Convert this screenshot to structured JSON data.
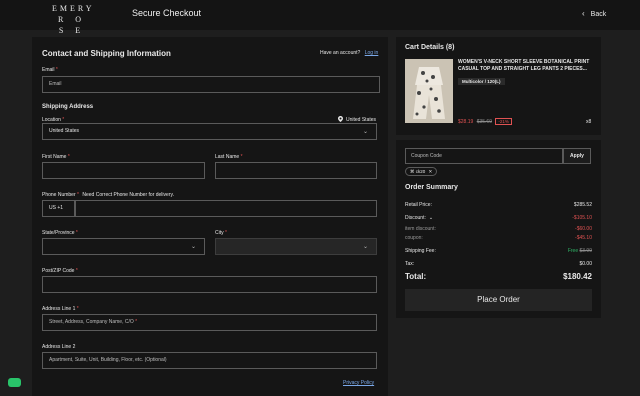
{
  "brand": {
    "line1": "EMERY",
    "line2": "R O S E"
  },
  "header": {
    "title": "Secure Checkout",
    "back_label": "Back"
  },
  "contact": {
    "title": "Contact and Shipping Information",
    "have_account": "Have an account?",
    "login_label": "Log in",
    "email_label": "Email",
    "email_placeholder": "Email"
  },
  "shipping": {
    "title": "Shipping Address",
    "location_label": "Location",
    "location_value": "United States",
    "location_hint": "United States",
    "first_name_label": "First Name",
    "last_name_label": "Last Name",
    "phone_label": "Phone Number",
    "phone_note": "Need Correct Phone Number for delivery.",
    "phone_code": "US +1",
    "state_label": "State/Province",
    "city_label": "City",
    "zip_label": "Post/ZIP Code",
    "address1_label": "Address Line 1",
    "address1_placeholder": "Street, Address, Company Name, C/O",
    "address2_label": "Address Line 2",
    "address2_placeholder": "Apartment, Suite, Unit, Building, Floor, etc. (Optional)",
    "privacy_label": "Privacy Policy"
  },
  "cart": {
    "title": "Cart Details (8)",
    "item": {
      "name": "WOMEN'S V-NECK SHORT SLEEVE BOTANICAL PRINT CASUAL TOP AND STRAIGHT LEG PANTS 2 PIECES...",
      "variant": "Multicolor / 120(L)",
      "price": "$28.19",
      "original_price": "$35.69",
      "discount": "-21%",
      "qty": "x8"
    }
  },
  "summary": {
    "coupon_placeholder": "Coupon Code",
    "apply_label": "Apply",
    "coupon_tag": "ck20",
    "title": "Order Summary",
    "retail_label": "Retail Price:",
    "retail_value": "$285.52",
    "discount_label": "Discount:",
    "discount_value": "-$105.10",
    "item_discount_label": "item discount:",
    "item_discount_value": "-$60.00",
    "coupon_label": "coupon:",
    "coupon_value": "-$45.10",
    "shipping_label": "Shipping Fee:",
    "shipping_free": "Free",
    "shipping_old": "$3.99",
    "tax_label": "Tax:",
    "tax_value": "$0.00",
    "total_label": "Total:",
    "total_value": "$180.42",
    "place_order_label": "Place Order"
  },
  "colors": {
    "accent_red": "#e05252",
    "free_green": "#2fb366",
    "background": "#1e1e1e",
    "panel": "#151515"
  }
}
